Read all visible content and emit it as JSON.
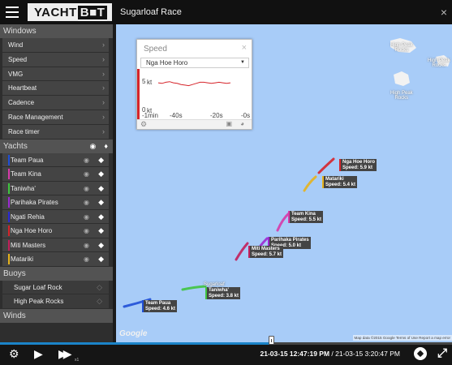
{
  "app": {
    "logo_text": "YACHT",
    "logo_suffix": "B■T",
    "race_title": "Sugarloaf Race",
    "close_glyph": "×"
  },
  "sidebar": {
    "windows_header": "Windows",
    "windows": [
      "Wind",
      "Speed",
      "VMG",
      "Heartbeat",
      "Cadence",
      "Race Management",
      "Race timer"
    ],
    "yachts_header": "Yachts",
    "yachts": [
      {
        "name": "Team Paua",
        "color": "#1f4fd6"
      },
      {
        "name": "Team Kina",
        "color": "#d63aa9"
      },
      {
        "name": "Taniwha'",
        "color": "#3fc43f"
      },
      {
        "name": "Parihaka Pirates",
        "color": "#9b2ad1"
      },
      {
        "name": "Ngati Rehia",
        "color": "#2a2ad6"
      },
      {
        "name": "Nga Hoe Horo",
        "color": "#d6242a"
      },
      {
        "name": "Miti Masters",
        "color": "#c21f5b"
      },
      {
        "name": "Matariki",
        "color": "#e5b21d"
      }
    ],
    "buoys_header": "Buoys",
    "buoys": [
      "Sugar Loaf Rock",
      "High Peak Rocks"
    ],
    "winds_header": "Winds"
  },
  "speed_widget": {
    "title": "Speed",
    "selected_yacht": "Nga Hoe Horo",
    "y_ticks": [
      "5",
      "0"
    ],
    "y_units": [
      "kt",
      "kt"
    ],
    "x_ticks": [
      "-1min",
      "-40s",
      "-20s",
      "-0s"
    ],
    "line_color": "#d6242a",
    "series": [
      4.7,
      4.6,
      4.8,
      4.9,
      4.7,
      4.6,
      4.4,
      4.3,
      4.2,
      4.4,
      4.6,
      4.8,
      4.8,
      4.7,
      4.6,
      4.7,
      4.8,
      4.7,
      4.6,
      4.7
    ]
  },
  "map": {
    "islands": [
      "High Peak\nRocks",
      "High Peak\nRocks",
      "High Peak\nRocks"
    ],
    "labels": [
      {
        "name": "Nga Hoe Horo",
        "speed": "Speed: 5.9 kt",
        "color": "#d6242a"
      },
      {
        "name": "Matariki",
        "speed": "Speed: 5.4 kt",
        "color": "#e5b21d"
      },
      {
        "name": "Team Kina",
        "speed": "Speed: 5.5 kt",
        "color": "#d63aa9"
      },
      {
        "name": "Parihaka Pirates",
        "speed": "Speed: 5.0 kt",
        "color": "#9b2ad1"
      },
      {
        "name": "Miti Masters",
        "speed": "Speed: 5.7 kt",
        "color": "#c21f5b"
      },
      {
        "name": "Taniwha'",
        "speed": "Speed: 3.8 kt",
        "color": "#3fc43f"
      },
      {
        "name": "Team Paua",
        "speed": "Speed: 4.6 kt",
        "color": "#1f4fd6"
      }
    ],
    "buoy_label": "Sugarloaf",
    "google": "Google",
    "attribution": "Map data ©2015 Google   Terms of Use   Report a map error"
  },
  "controls": {
    "progress": 0.6,
    "speed_multiplier": "x1",
    "current_time": "21-03-15 12:47:19 PM",
    "end_time": "21-03-15 3:20:47 PM"
  }
}
